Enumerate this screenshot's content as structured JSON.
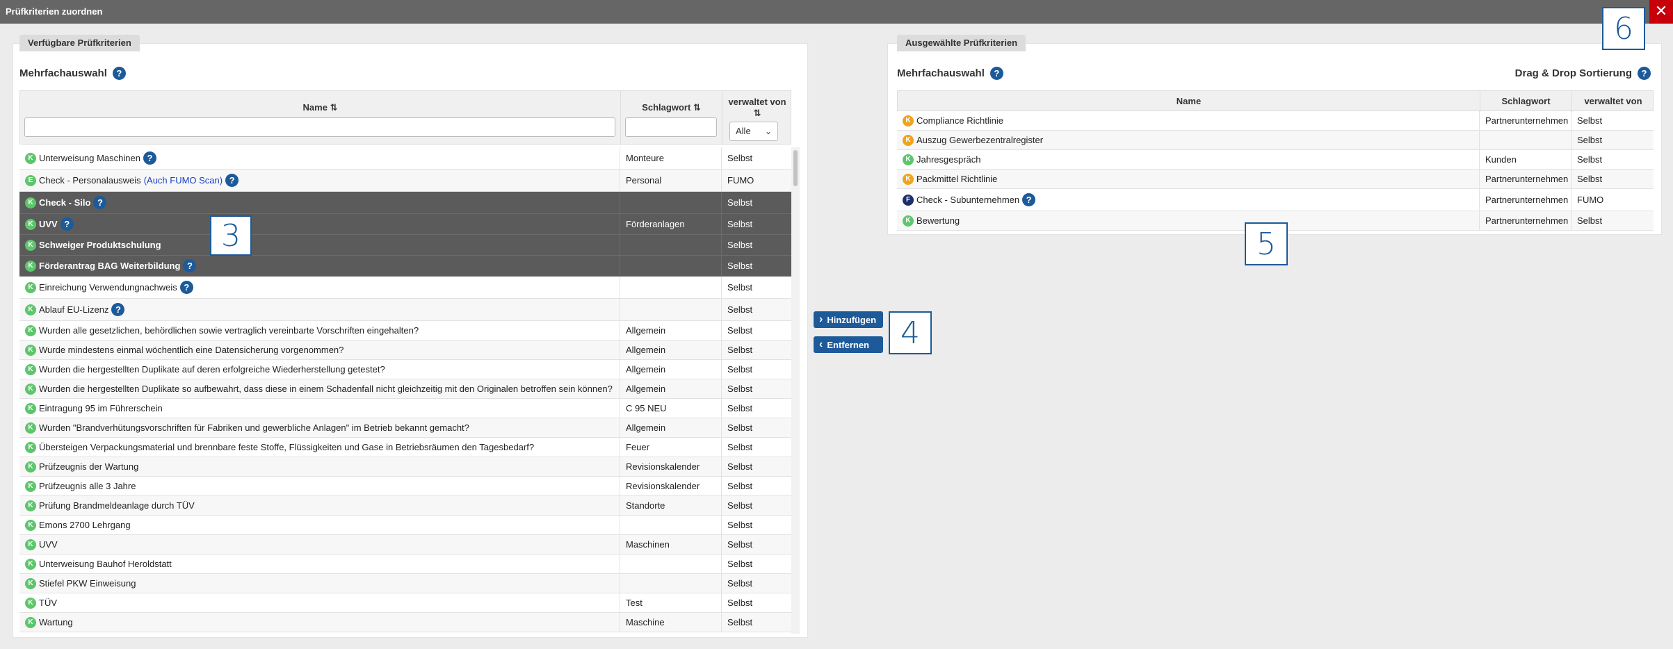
{
  "window": {
    "title": "Prüfkriterien zuordnen",
    "close": "✕"
  },
  "left": {
    "tab": "Verfügbare Prüfkriterien",
    "section": "Mehrfachauswahl",
    "headers": {
      "name": "Name ⇅",
      "keyword": "Schlagwort ⇅",
      "managed_line1": "verwaltet von",
      "managed_line2": "⇅"
    },
    "filter_select": "Alle",
    "rows": [
      {
        "badge": "K",
        "name": "Unterweisung Maschinen",
        "help": true,
        "keyword": "Monteure",
        "managed": "Selbst",
        "selected": false
      },
      {
        "badge": "E",
        "name": "Check - Personalausweis",
        "link": "(Auch FUMO Scan)",
        "help": true,
        "keyword": "Personal",
        "managed": "FUMO",
        "selected": false
      },
      {
        "badge": "K",
        "name": "Check - Silo",
        "help": true,
        "keyword": "",
        "managed": "Selbst",
        "selected": true
      },
      {
        "badge": "K",
        "name": "UVV",
        "help": true,
        "keyword": "Förderanlagen",
        "managed": "Selbst",
        "selected": true
      },
      {
        "badge": "K",
        "name": "Schweiger Produktschulung",
        "help": false,
        "keyword": "",
        "managed": "Selbst",
        "selected": true
      },
      {
        "badge": "K",
        "name": "Förderantrag BAG Weiterbildung",
        "help": true,
        "keyword": "",
        "managed": "Selbst",
        "selected": true
      },
      {
        "badge": "K",
        "name": "Einreichung Verwendungnachweis",
        "help": true,
        "keyword": "",
        "managed": "Selbst",
        "selected": false
      },
      {
        "badge": "K",
        "name": "Ablauf EU-Lizenz",
        "help": true,
        "keyword": "",
        "managed": "Selbst",
        "selected": false
      },
      {
        "badge": "K",
        "name": "Wurden alle gesetzlichen, behördlichen sowie vertraglich vereinbarte Vorschriften eingehalten?",
        "help": false,
        "keyword": "Allgemein",
        "managed": "Selbst",
        "selected": false
      },
      {
        "badge": "K",
        "name": "Wurde mindestens einmal wöchentlich eine Datensicherung vorgenommen?",
        "help": false,
        "keyword": "Allgemein",
        "managed": "Selbst",
        "selected": false
      },
      {
        "badge": "K",
        "name": "Wurden die hergestellten Duplikate auf deren erfolgreiche Wiederherstellung getestet?",
        "help": false,
        "keyword": "Allgemein",
        "managed": "Selbst",
        "selected": false
      },
      {
        "badge": "K",
        "name": "Wurden die hergestellten Duplikate so aufbewahrt, dass diese in einem Schadenfall nicht gleichzeitig mit den Originalen betroffen sein können?",
        "help": false,
        "keyword": "Allgemein",
        "managed": "Selbst",
        "selected": false
      },
      {
        "badge": "K",
        "name": "Eintragung 95 im Führerschein",
        "help": false,
        "keyword": "C 95 NEU",
        "managed": "Selbst",
        "selected": false
      },
      {
        "badge": "K",
        "name": "Wurden \"Brandverhütungsvorschriften für Fabriken und gewerbliche Anlagen\" im Betrieb bekannt gemacht?",
        "help": false,
        "keyword": "Allgemein",
        "managed": "Selbst",
        "selected": false
      },
      {
        "badge": "K",
        "name": "Übersteigen Verpackungsmaterial und brennbare feste Stoffe, Flüssigkeiten und Gase in Betriebsräumen den Tagesbedarf?",
        "help": false,
        "keyword": "Feuer",
        "managed": "Selbst",
        "selected": false
      },
      {
        "badge": "K",
        "name": "Prüfzeugnis der Wartung",
        "help": false,
        "keyword": "Revisionskalender",
        "managed": "Selbst",
        "selected": false
      },
      {
        "badge": "K",
        "name": "Prüfzeugnis alle 3 Jahre",
        "help": false,
        "keyword": "Revisionskalender",
        "managed": "Selbst",
        "selected": false
      },
      {
        "badge": "K",
        "name": "Prüfung Brandmeldeanlage durch TÜV",
        "help": false,
        "keyword": "Standorte",
        "managed": "Selbst",
        "selected": false
      },
      {
        "badge": "K",
        "name": "Emons 2700 Lehrgang",
        "help": false,
        "keyword": "",
        "managed": "Selbst",
        "selected": false
      },
      {
        "badge": "K",
        "name": "UVV",
        "help": false,
        "keyword": "Maschinen",
        "managed": "Selbst",
        "selected": false
      },
      {
        "badge": "K",
        "name": "Unterweisung Bauhof Heroldstatt",
        "help": false,
        "keyword": "",
        "managed": "Selbst",
        "selected": false
      },
      {
        "badge": "K",
        "name": "Stiefel PKW Einweisung",
        "help": false,
        "keyword": "",
        "managed": "Selbst",
        "selected": false
      },
      {
        "badge": "K",
        "name": "TÜV",
        "help": false,
        "keyword": "Test",
        "managed": "Selbst",
        "selected": false
      },
      {
        "badge": "K",
        "name": "Wartung",
        "help": false,
        "keyword": "Maschine",
        "managed": "Selbst",
        "selected": false
      }
    ]
  },
  "actions": {
    "add": "Hinzufügen",
    "remove": "Entfernen"
  },
  "right": {
    "tab": "Ausgewählte Prüfkriterien",
    "section": "Mehrfachauswahl",
    "sort_label": "Drag & Drop Sortierung",
    "headers": {
      "name": "Name",
      "keyword": "Schlagwort",
      "managed": "verwaltet von"
    },
    "rows": [
      {
        "badge": "O",
        "letter": "K",
        "name": "Compliance Richtlinie",
        "help": false,
        "keyword": "Partnerunternehmen",
        "managed": "Selbst"
      },
      {
        "badge": "O",
        "letter": "K",
        "name": "Auszug Gewerbezentralregister",
        "help": false,
        "keyword": "",
        "managed": "Selbst"
      },
      {
        "badge": "K",
        "letter": "K",
        "name": "Jahresgespräch",
        "help": false,
        "keyword": "Kunden",
        "managed": "Selbst"
      },
      {
        "badge": "O",
        "letter": "K",
        "name": "Packmittel Richtlinie",
        "help": false,
        "keyword": "Partnerunternehmen",
        "managed": "Selbst"
      },
      {
        "badge": "F",
        "letter": "F",
        "name": "Check - Subunternehmen",
        "help": true,
        "keyword": "Partnerunternehmen",
        "managed": "FUMO"
      },
      {
        "badge": "K",
        "letter": "K",
        "name": "Bewertung",
        "help": false,
        "keyword": "Partnerunternehmen",
        "managed": "Selbst"
      }
    ]
  },
  "callouts": {
    "c3": "3",
    "c4": "4",
    "c5": "5",
    "c6": "6"
  },
  "icons": {
    "help": "?",
    "chevron_down": "⌄",
    "arrow_right": "›",
    "arrow_left": "‹"
  }
}
